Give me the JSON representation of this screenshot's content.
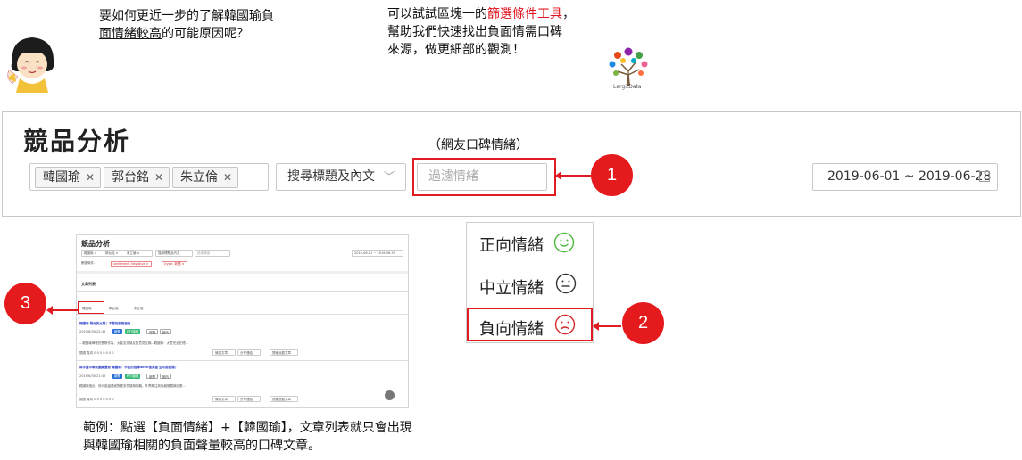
{
  "captions": {
    "left_line1": "要如何更近一步的了解韓國瑜負",
    "left_line2_u": "面情緒較高",
    "left_line2_rest": "的可能原因呢？",
    "right_line1_a": "可以試試區塊一的",
    "right_line1_red": "篩選條件工具",
    "right_line1_b": "，",
    "right_line2": "幫助我們快速找出負面情需口碑",
    "right_line3": "來源，做更細部的觀測！"
  },
  "logo": {
    "text": "LargitData"
  },
  "panel": {
    "title": "競品分析",
    "note": "（網友口碑情緒）",
    "tags": [
      "韓國瑜",
      "郭台銘",
      "朱立倫"
    ],
    "tag_remove": "✕",
    "search_scope": "搜尋標題及內文",
    "filter_placeholder": "過濾情緒",
    "date_range": "2019-06-01 ~ 2019-06-28"
  },
  "markers": {
    "one": "1",
    "two": "2",
    "three": "3"
  },
  "mood": {
    "items": [
      {
        "label": "正向情緒",
        "face": "smile-icon",
        "color": "#4cbb3c"
      },
      {
        "label": "中立情緒",
        "face": "neutral-icon",
        "color": "#333333"
      },
      {
        "label": "負向情緒",
        "face": "frown-icon",
        "color": "#d42a2a"
      }
    ]
  },
  "mini": {
    "title": "競品分析",
    "tags": [
      "韓國瑜 ×",
      "郭台銘 ×",
      "朱立倫 ×"
    ],
    "scope": "搜尋標題及內文",
    "filter": "過濾情緒",
    "date": "2019-06-01 ~ 2019-06-30",
    "filter_label": "篩選條件：",
    "chips": [
      "sentiment: Negative ×",
      "(type: 新聞 ×"
    ],
    "list_title": "文章列表",
    "tabs": [
      "韓國瑜",
      "郭台銘",
      "朱立倫"
    ],
    "articles": [
      {
        "title": "韓國瑜 陽光的太陽！不要說服都被他...",
        "meta": "2019/6/30 22:48",
        "badges": [
          "新聞",
          "PTT論壇",
          "新聞",
          "國內"
        ],
        "snippet": "...韓國瑜陣營的實際作為，大量支持與反對意見交織...韓國瑜：大意完全在理...",
        "actions": "閱讀 負向   0   0   0   0   0   0   0"
      },
      {
        "title": "郭宇翼中華民國總畫冊 韓國瑜：市民的指揮4600億美金 生可能被傷？",
        "meta": "2019/6/30 21:43",
        "badges": [
          "新聞",
          "PTT論壇",
          "新聞",
          "國內"
        ],
        "snippet": "韓國瑜指出，他可能還要面對更多質疑與挑戰，外界關注其後續發展與回應...",
        "actions": "閱讀 負向   0   0   0   0   0   0   0"
      }
    ],
    "btns": [
      "情感文章",
      "分享連結",
      "提議此觀文章"
    ]
  },
  "footer": {
    "line1": "範例：點選【負面情緒】+【韓國瑜】，文章列表就只會出現",
    "line2": "與韓國瑜相關的負面聲量較高的口碑文章。"
  }
}
